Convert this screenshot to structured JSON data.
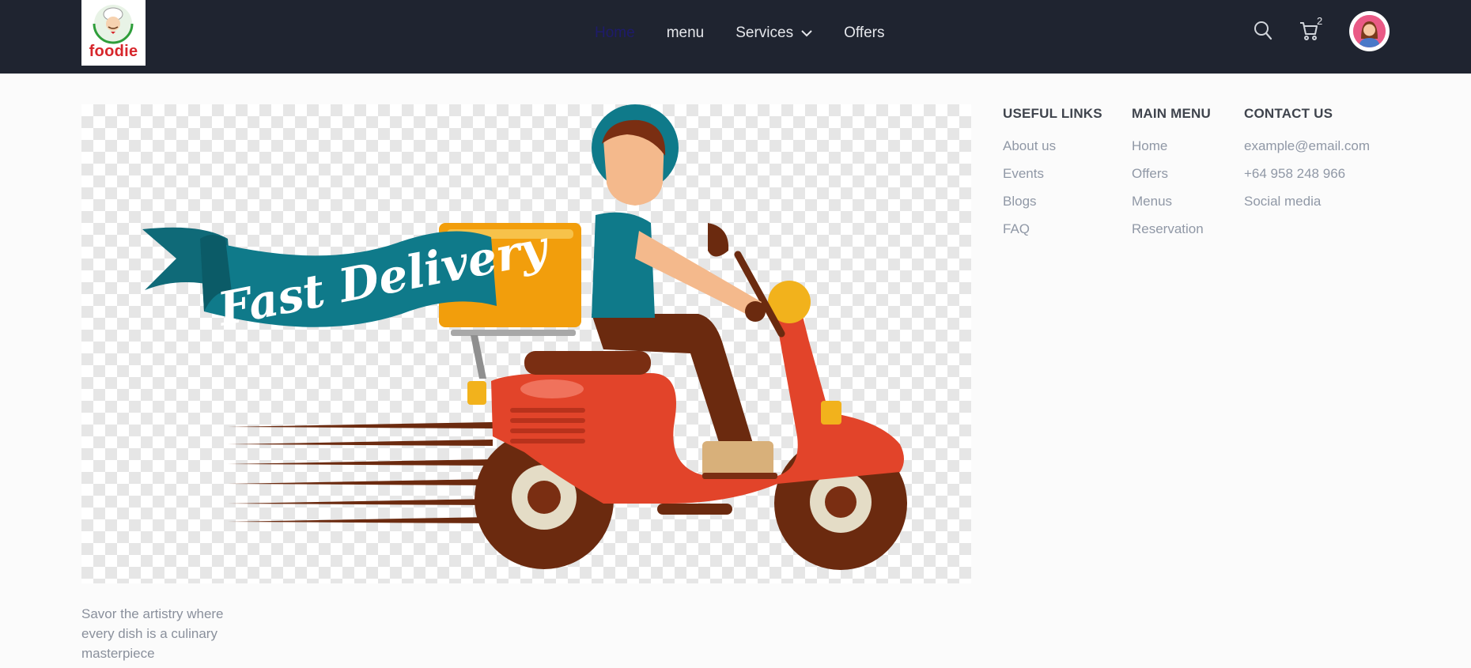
{
  "brand": {
    "logo_text": "foodie"
  },
  "nav": {
    "links": [
      {
        "label": "Home",
        "active": true
      },
      {
        "label": "menu"
      },
      {
        "label": "Services",
        "has_dropdown": true
      },
      {
        "label": "Offers"
      }
    ],
    "cart_count": "2",
    "icons": [
      "search-icon",
      "cart-icon",
      "user-avatar"
    ]
  },
  "hero": {
    "banner_text": "Fast Delivery"
  },
  "tagline": "Savor the artistry where every dish is a culinary masterpiece",
  "footer": {
    "columns": [
      {
        "heading": "USEFUL LINKS",
        "links": [
          "About us",
          "Events",
          "Blogs",
          "FAQ"
        ]
      },
      {
        "heading": "MAIN MENU",
        "links": [
          "Home",
          "Offers",
          "Menus",
          "Reservation"
        ]
      },
      {
        "heading": "CONTACT US",
        "links": [
          "example@email.com",
          "+64 958 248 966",
          "Social media"
        ]
      }
    ]
  },
  "colors": {
    "navbar_bg": "#1f2430",
    "page_bg": "#fbfbfb",
    "brand_red": "#d7262b",
    "scooter_red": "#e2442a",
    "banner_teal": "#0f7a8a",
    "box_orange": "#f29e0c"
  }
}
